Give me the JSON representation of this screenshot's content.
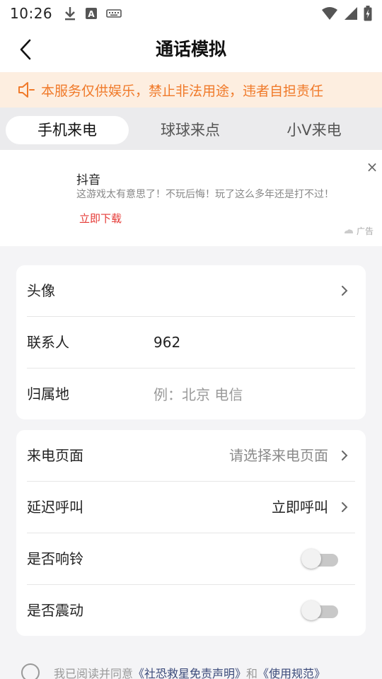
{
  "status_bar": {
    "time": "10:26"
  },
  "nav": {
    "title": "通话模拟"
  },
  "notice": {
    "text": "本服务仅供娱乐，禁止非法用途，违者自担责任",
    "color": "#f07a2a"
  },
  "tabs": [
    {
      "label": "手机来电",
      "active": true
    },
    {
      "label": "球球来点",
      "active": false
    },
    {
      "label": "小V来电",
      "active": false
    }
  ],
  "ad": {
    "title": "抖音",
    "desc": "这游戏太有意思了！不玩后悔！玩了这么多年还是打不过！",
    "cta": "立即下载",
    "close": "×",
    "tag": "广告"
  },
  "form": {
    "avatar_label": "头像",
    "contact_label": "联系人",
    "contact_value": "962",
    "location_label": "归属地",
    "location_placeholder": "例：北京 电信",
    "page_label": "来电页面",
    "page_value": "请选择来电页面",
    "delay_label": "延迟呼叫",
    "delay_value": "立即呼叫",
    "ring_label": "是否响铃",
    "ring_on": false,
    "vibrate_label": "是否震动",
    "vibrate_on": false
  },
  "agreement": {
    "prefix": "我已阅读并同意",
    "link1": "《社恐救星免责声明》",
    "and": "和",
    "link2": "《使用规范》"
  },
  "colors": {
    "accent_orange": "#f07a2a",
    "ad_cta_red": "#e53935",
    "link_blue": "#3b4a7a"
  }
}
